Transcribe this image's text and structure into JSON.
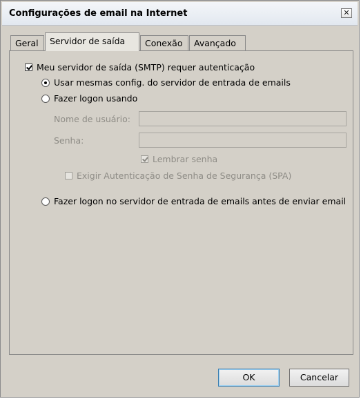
{
  "dialog": {
    "title": "Configurações de email na Internet",
    "close_symbol": "✕"
  },
  "tabs": [
    {
      "label": "Geral",
      "active": false
    },
    {
      "label": "Servidor de saída",
      "active": true
    },
    {
      "label": "Conexão",
      "active": false
    },
    {
      "label": "Avançado",
      "active": false
    }
  ],
  "outgoing": {
    "requires_auth_label": "Meu servidor de saída (SMTP) requer autenticação",
    "requires_auth_checked": true,
    "use_same_settings_label": "Usar mesmas config. do servidor de entrada de emails",
    "use_same_settings_selected": true,
    "log_on_using_label": "Fazer logon usando",
    "log_on_using_selected": false,
    "username_label": "Nome de usuário:",
    "username_value": "",
    "password_label": "Senha:",
    "password_value": "",
    "remember_password_label": "Lembrar senha",
    "remember_password_checked": true,
    "spa_label": "Exigir Autenticação de Senha de Segurança (SPA)",
    "spa_checked": false,
    "log_on_incoming_first_label": "Fazer logon no servidor de entrada de emails antes de enviar email",
    "log_on_incoming_first_selected": false
  },
  "buttons": {
    "ok_label": "OK",
    "cancel_label": "Cancelar"
  },
  "icons": {
    "close": "close-icon",
    "checkmark": "checkmark-icon",
    "radio_dot": "radio-dot-icon"
  }
}
